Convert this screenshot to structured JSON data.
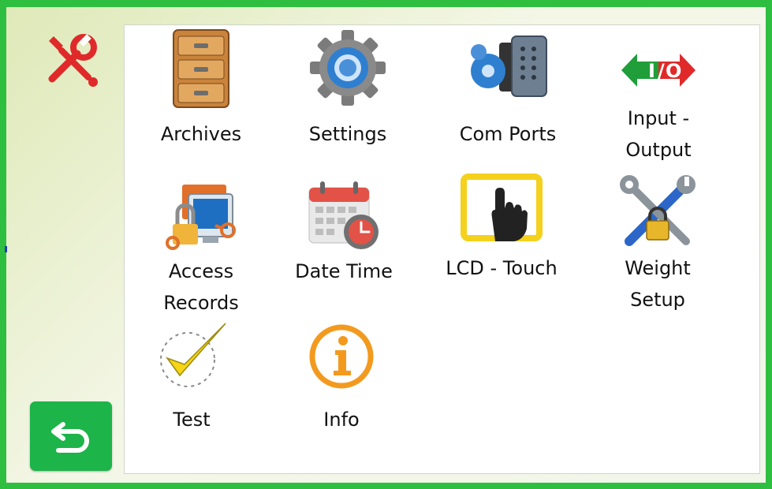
{
  "colors": {
    "frame": "#2fbf40",
    "back_button": "#1db44a",
    "tools_icon": "#e02a2a",
    "info_icon": "#f39a1e"
  },
  "sidebar": {
    "tools_icon": "wrench-screwdriver-icon",
    "back_icon": "return-arrow-icon"
  },
  "menu": {
    "items": [
      {
        "label": "Archives",
        "icon": "filing-cabinet-icon"
      },
      {
        "label": "Settings",
        "icon": "gear-icon"
      },
      {
        "label": "Com Ports",
        "icon": "serial-port-icon"
      },
      {
        "label": "Input -\nOutput",
        "icon": "input-output-arrows-icon"
      },
      {
        "label": "Access\nRecords",
        "icon": "access-lock-computer-icon"
      },
      {
        "label": "Date Time",
        "icon": "calendar-clock-icon"
      },
      {
        "label": "LCD - Touch",
        "icon": "touch-screen-hand-icon"
      },
      {
        "label": "Weight\nSetup",
        "icon": "wrench-lock-icon"
      },
      {
        "label": "Test",
        "icon": "checkmark-icon"
      },
      {
        "label": "Info",
        "icon": "info-icon"
      }
    ]
  }
}
